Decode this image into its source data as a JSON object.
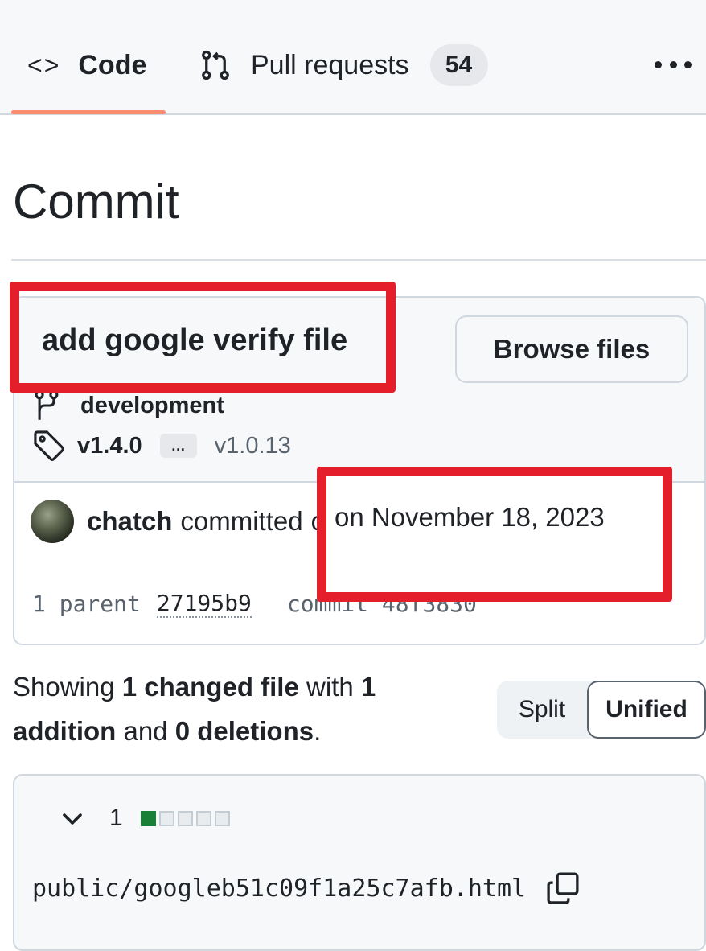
{
  "tabs": {
    "code_label": "Code",
    "code_icon": "code-icon",
    "pull_requests_label": "Pull requests",
    "pull_requests_icon": "git-pull-request-icon",
    "pull_requests_count": "54",
    "more_icon": "kebab-horizontal-icon",
    "active_underline_color": "#fd8c73"
  },
  "page": {
    "title": "Commit"
  },
  "commit": {
    "message": "add google verify file",
    "browse_files_label": "Browse files",
    "branch_icon": "git-branch-icon",
    "branch": "development",
    "tag_icon": "tag-icon",
    "tag_main": "v1.4.0",
    "tag_ellipsis": "…",
    "tag_other": "v1.0.13",
    "author": "chatch",
    "action": "committed",
    "date": "on November 18, 2023",
    "parent_label": "1 parent",
    "parent_sha": "27195b9",
    "commit_label": "commit 48f3830"
  },
  "summary": {
    "prefix": "Showing ",
    "changed_files": "1 changed file",
    "with": " with ",
    "additions": "1 addition",
    "and": " and ",
    "deletions": "0 deletions",
    "suffix": "."
  },
  "view_toggle": {
    "split_label": "Split",
    "unified_label": "Unified",
    "selected": "Unified"
  },
  "file": {
    "chevron_icon": "chevron-down-icon",
    "changes_count": "1",
    "diffstat": {
      "additions": 1,
      "total_blocks": 5
    },
    "path": "public/googleb51c09f1a25c7afb.html",
    "copy_icon": "copy-icon",
    "addition_color": "#1a7f37"
  },
  "annotation_color": "#e51e2b"
}
